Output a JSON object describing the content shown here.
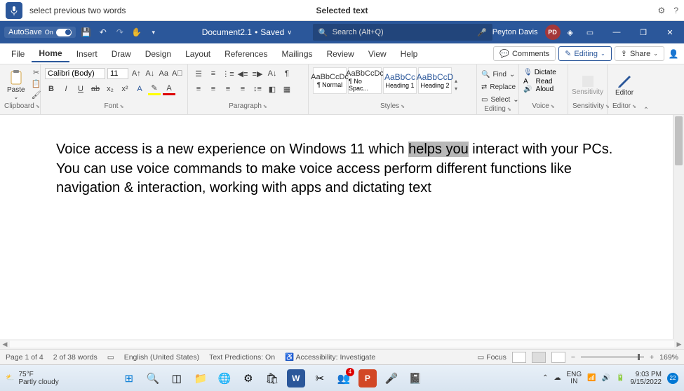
{
  "voice_bar": {
    "command_text": "select previous two words",
    "feedback": "Selected text"
  },
  "title_bar": {
    "autosave_label": "AutoSave",
    "doc_name": "Document2.1",
    "save_status": "Saved",
    "search_placeholder": "Search (Alt+Q)",
    "user_name": "Peyton Davis",
    "user_initials": "PD"
  },
  "tabs": {
    "items": [
      "File",
      "Home",
      "Insert",
      "Draw",
      "Design",
      "Layout",
      "References",
      "Mailings",
      "Review",
      "View",
      "Help"
    ],
    "active": "Home",
    "comments_label": "Comments",
    "editing_label": "Editing",
    "share_label": "Share"
  },
  "ribbon": {
    "clipboard": {
      "paste": "Paste",
      "label": "Clipboard"
    },
    "font": {
      "name": "Calibri (Body)",
      "size": "11",
      "label": "Font"
    },
    "paragraph": {
      "label": "Paragraph"
    },
    "styles": {
      "label": "Styles",
      "items": [
        {
          "preview": "AaBbCcDc",
          "name": "¶ Normal"
        },
        {
          "preview": "AaBbCcDc",
          "name": "¶ No Spac..."
        },
        {
          "preview": "AaBbCc",
          "name": "Heading 1"
        },
        {
          "preview": "AaBbCcD",
          "name": "Heading 2"
        }
      ]
    },
    "editing": {
      "find": "Find",
      "replace": "Replace",
      "select": "Select",
      "label": "Editing"
    },
    "voice": {
      "dictate": "Dictate",
      "read": "Read Aloud",
      "label": "Voice"
    },
    "sensitivity": {
      "btn": "Sensitivity",
      "label": "Sensitivity"
    },
    "editor": {
      "btn": "Editor",
      "label": "Editor"
    }
  },
  "document": {
    "before_sel": "Voice access is a new experience on Windows 11 which ",
    "selected": "helps you",
    "after_sel": " interact with your PCs. You can use voice commands to make voice access perform different functions like navigation & interaction, working with apps and dictating text"
  },
  "status": {
    "page": "Page 1 of 4",
    "words": "2 of 38 words",
    "lang": "English (United States)",
    "pred": "Text Predictions: On",
    "a11y": "Accessibility: Investigate",
    "focus": "Focus",
    "zoom": "169%"
  },
  "taskbar": {
    "temp": "75°F",
    "cond": "Partly cloudy",
    "lang1": "ENG",
    "lang2": "IN",
    "time": "9:03 PM",
    "date": "9/15/2022",
    "badge": "4",
    "noti": "22"
  }
}
